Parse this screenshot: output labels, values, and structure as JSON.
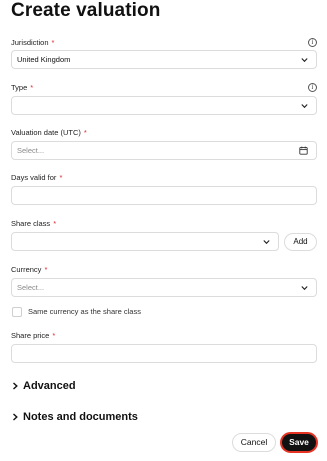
{
  "page_title": "Create valuation",
  "required_marker": "*",
  "colors": {
    "required": "#e0242f",
    "save_border": "#e53424",
    "save_bg": "#111111"
  },
  "form": {
    "jurisdiction": {
      "label": "Jurisdiction",
      "value": "United Kingdom",
      "info_icon": "i"
    },
    "type": {
      "label": "Type",
      "value": "",
      "info_icon": "i"
    },
    "valuation_date": {
      "label": "Valuation date (UTC)",
      "placeholder": "Select..."
    },
    "days_valid": {
      "label": "Days valid for",
      "value": ""
    },
    "share_class": {
      "label": "Share class",
      "value": "",
      "add_label": "Add"
    },
    "currency": {
      "label": "Currency",
      "placeholder": "Select..."
    },
    "same_currency": {
      "label": "Same currency as the share class",
      "checked": false
    },
    "share_price": {
      "label": "Share price",
      "value": ""
    }
  },
  "sections": {
    "advanced": "Advanced",
    "notes": "Notes and documents"
  },
  "actions": {
    "cancel_label": "Cancel",
    "save_label": "Save"
  }
}
